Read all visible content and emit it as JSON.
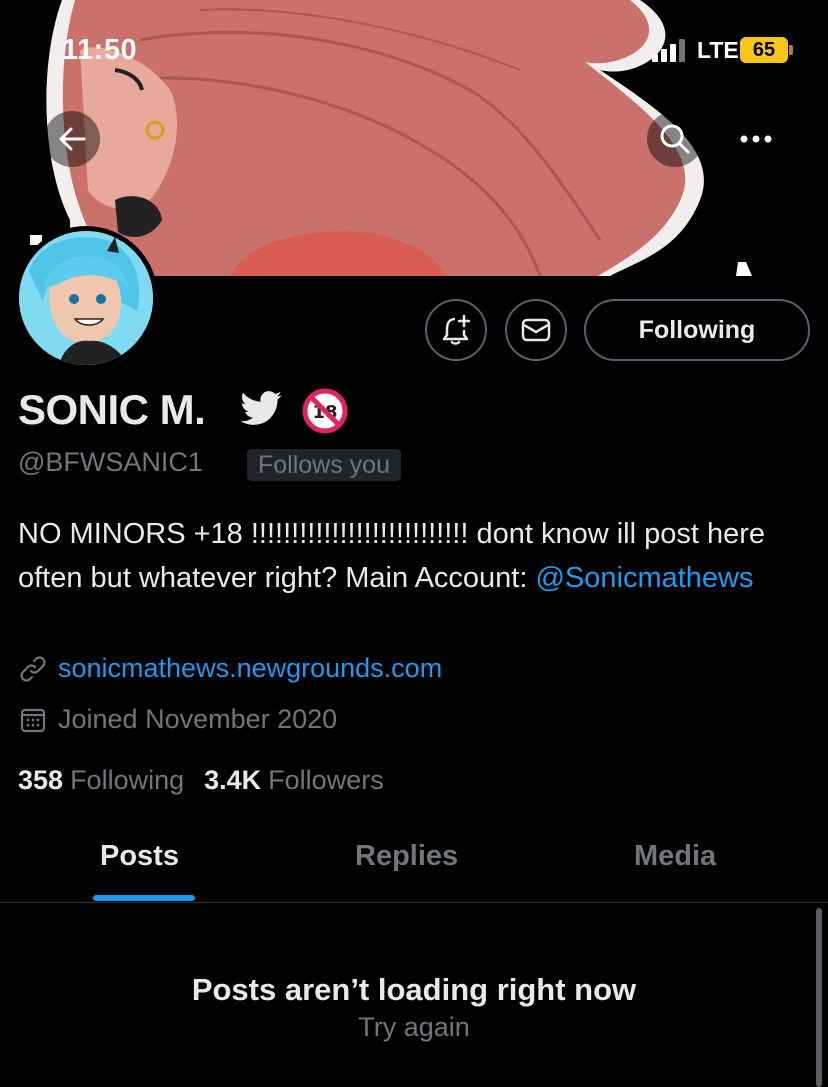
{
  "status_bar": {
    "time": "11:50",
    "network": "LTE",
    "battery": "65"
  },
  "header": {
    "back_icon": "arrow-left-icon",
    "search_icon": "search-icon",
    "more_icon": "more-horizontal-icon"
  },
  "profile": {
    "display_name": "SONIC M.",
    "handle": "@BFWSANIC1",
    "follows_you": "Follows you",
    "bio_text": "NO MINORS +18 !!!!!!!!!!!!!!!!!!!!!!!!!!! dont know ill post here often but whatever right? Main Account: ",
    "bio_mention": "@Sonicmathews",
    "website": "sonicmathews.newgrounds.com",
    "joined": "Joined November 2020",
    "following_count": "358",
    "following_label": "Following",
    "followers_count": "3.4K",
    "followers_label": "Followers"
  },
  "actions": {
    "following_button": "Following",
    "notify_icon": "bell-plus-icon",
    "message_icon": "envelope-icon"
  },
  "tabs": [
    {
      "label": "Posts",
      "active": true
    },
    {
      "label": "Replies",
      "active": false
    },
    {
      "label": "Media",
      "active": false
    }
  ],
  "feed": {
    "empty_title": "Posts aren’t loading right now",
    "retry_label": "Try again"
  },
  "colors": {
    "accent": "#1d9bf0",
    "muted": "#71767b",
    "background": "#000000",
    "battery": "#f5c518"
  }
}
